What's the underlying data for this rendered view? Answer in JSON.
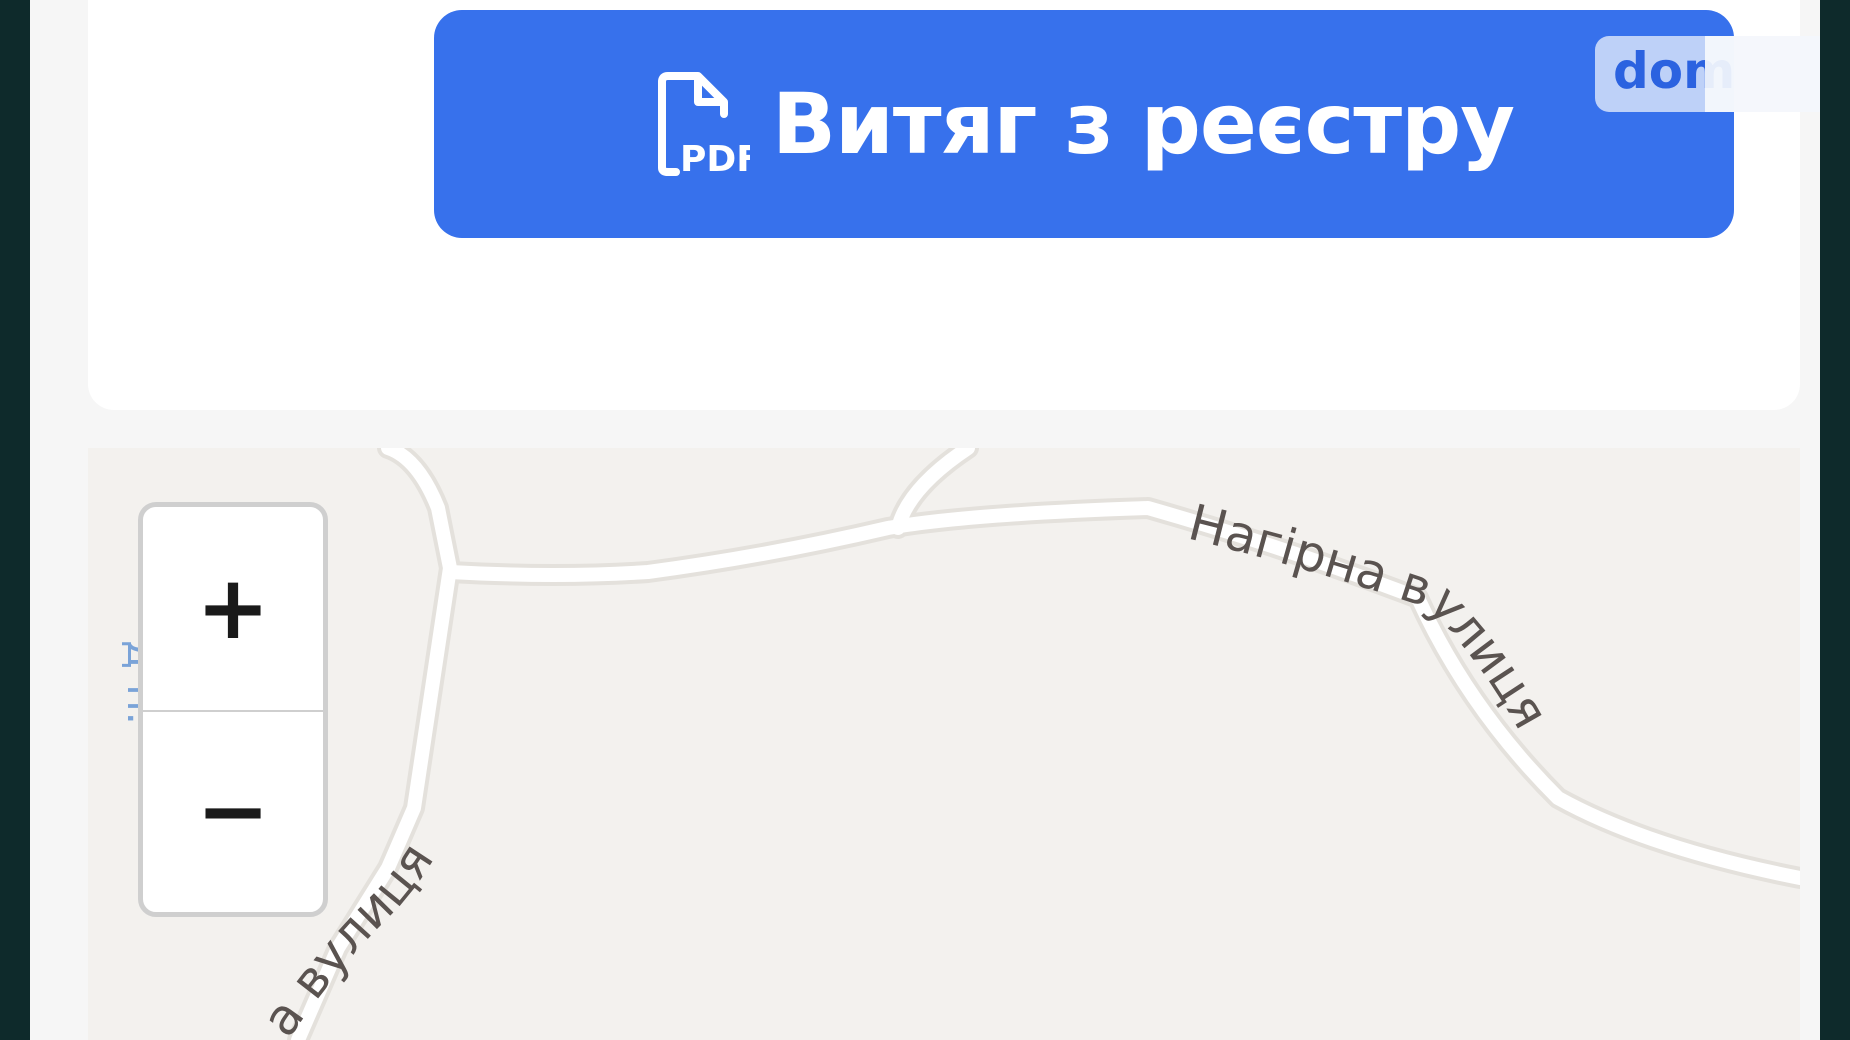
{
  "registry_button": {
    "label": "Витяг з реєстру",
    "icon": "pdf-file-icon",
    "icon_text": "PDF",
    "color": "#3771ec"
  },
  "watermark": {
    "text": "dom"
  },
  "map": {
    "zoom_in_label": "+",
    "zoom_out_label": "−",
    "streets": {
      "nahirna": "Нагірна вулиця",
      "left_street": "а вулиця",
      "edge_label": "—д-н."
    },
    "background_color": "#f3f1ee"
  }
}
